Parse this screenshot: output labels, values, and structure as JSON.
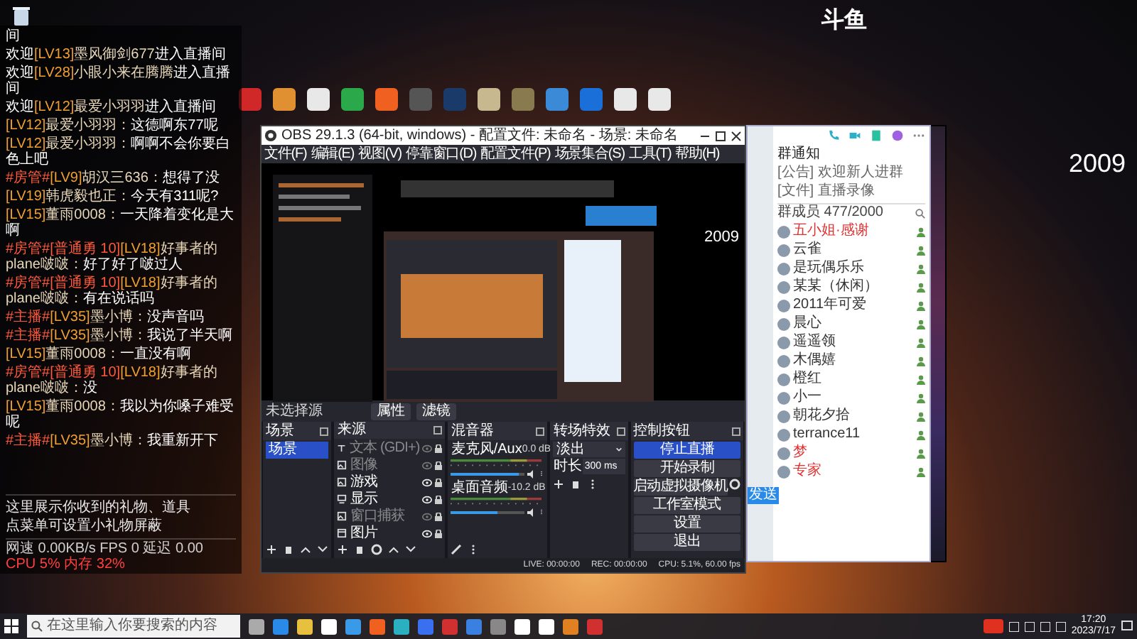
{
  "logo": "斗鱼",
  "counter": "2009",
  "chat": {
    "messages": [
      {
        "parts": [
          {
            "kind": "text",
            "text": "间"
          }
        ]
      },
      {
        "parts": [
          {
            "kind": "text",
            "text": "欢迎"
          },
          {
            "kind": "level",
            "text": "[LV13]"
          },
          {
            "kind": "user",
            "text": "墨风御剑677"
          },
          {
            "kind": "text",
            "text": "进入直播间"
          }
        ]
      },
      {
        "parts": [
          {
            "kind": "text",
            "text": "欢迎"
          },
          {
            "kind": "level",
            "text": "[LV28]"
          },
          {
            "kind": "user",
            "text": "小眼小来在腾腾"
          },
          {
            "kind": "text",
            "text": "进入直播间"
          }
        ]
      },
      {
        "parts": [
          {
            "kind": "text",
            "text": "欢迎"
          },
          {
            "kind": "level",
            "text": "[LV12]"
          },
          {
            "kind": "user",
            "text": "最爱小羽羽"
          },
          {
            "kind": "text",
            "text": "进入直播间"
          }
        ]
      },
      {
        "parts": [
          {
            "kind": "level",
            "text": "[LV12]"
          },
          {
            "kind": "user",
            "text": "最爱小羽羽："
          },
          {
            "kind": "text",
            "text": "这德啊东77呢"
          }
        ]
      },
      {
        "parts": [
          {
            "kind": "level",
            "text": "[LV12]"
          },
          {
            "kind": "user",
            "text": "最爱小羽羽："
          },
          {
            "kind": "text",
            "text": "啊啊不会你要白色上吧"
          }
        ]
      },
      {
        "parts": [
          {
            "kind": "badge",
            "text": "#房管#"
          },
          {
            "kind": "level",
            "text": "[LV9]"
          },
          {
            "kind": "user",
            "text": "胡汉三636："
          },
          {
            "kind": "text",
            "text": "想得了没"
          }
        ]
      },
      {
        "parts": [
          {
            "kind": "level",
            "text": "[LV19]"
          },
          {
            "kind": "user",
            "text": "韩虎毅也正："
          },
          {
            "kind": "text",
            "text": "今天有311呢?"
          }
        ]
      },
      {
        "parts": [
          {
            "kind": "level",
            "text": "[LV15]"
          },
          {
            "kind": "user",
            "text": "董雨0008："
          },
          {
            "kind": "text",
            "text": "一天降着变化是大啊"
          }
        ]
      },
      {
        "parts": [
          {
            "kind": "badge",
            "text": "#房管#[普通勇 10]"
          },
          {
            "kind": "level",
            "text": "[LV18]"
          },
          {
            "kind": "user",
            "text": "好事者的plane啵啵："
          },
          {
            "kind": "text",
            "text": "好了好了啵过人"
          }
        ]
      },
      {
        "parts": [
          {
            "kind": "badge",
            "text": "#房管#[普通勇 10]"
          },
          {
            "kind": "level",
            "text": "[LV18]"
          },
          {
            "kind": "user",
            "text": "好事者的plane啵啵："
          },
          {
            "kind": "text",
            "text": "有在说话吗"
          }
        ]
      },
      {
        "parts": [
          {
            "kind": "badge",
            "text": "#主播#"
          },
          {
            "kind": "level",
            "text": "[LV35]"
          },
          {
            "kind": "user",
            "text": "墨小博："
          },
          {
            "kind": "text",
            "text": "没声音吗"
          }
        ]
      },
      {
        "parts": [
          {
            "kind": "badge",
            "text": "#主播#"
          },
          {
            "kind": "level",
            "text": "[LV35]"
          },
          {
            "kind": "user",
            "text": "墨小博："
          },
          {
            "kind": "text",
            "text": "我说了半天啊"
          }
        ]
      },
      {
        "parts": [
          {
            "kind": "level",
            "text": "[LV15]"
          },
          {
            "kind": "user",
            "text": "董雨0008："
          },
          {
            "kind": "text",
            "text": "一直没有啊"
          }
        ]
      },
      {
        "parts": [
          {
            "kind": "badge",
            "text": "#房管#[普通勇 10]"
          },
          {
            "kind": "level",
            "text": "[LV18]"
          },
          {
            "kind": "user",
            "text": "好事者的plane啵啵："
          },
          {
            "kind": "text",
            "text": "没"
          }
        ]
      },
      {
        "parts": [
          {
            "kind": "level",
            "text": "[LV15]"
          },
          {
            "kind": "user",
            "text": "董雨0008："
          },
          {
            "kind": "text",
            "text": "我以为你嗓子难受呢"
          }
        ]
      },
      {
        "parts": [
          {
            "kind": "badge",
            "text": "#主播#"
          },
          {
            "kind": "level",
            "text": "[LV35]"
          },
          {
            "kind": "user",
            "text": "墨小博："
          },
          {
            "kind": "text",
            "text": "我重新开下"
          }
        ]
      }
    ],
    "footer": [
      "这里展示你收到的礼物、道具",
      "点菜单可设置小礼物屏蔽"
    ],
    "status_left": "网速 0.00KB/s FPS 0 延迟 0.00",
    "status_right": "CPU 5% 内存 32%"
  },
  "obs": {
    "title": "OBS 29.1.3 (64-bit, windows) - 配置文件: 未命名 - 场景: 未命名",
    "menu": [
      "文件(F)",
      "编辑(E)",
      "视图(V)",
      "停靠窗口(D)",
      "配置文件(P)",
      "场景集合(S)",
      "工具(T)",
      "帮助(H)"
    ],
    "preview_counter": "2009",
    "source_bar": {
      "label": "未选择源",
      "buttons": [
        "属性",
        "滤镜"
      ]
    },
    "scenes": {
      "title": "场景",
      "items": [
        {
          "name": "场景",
          "selected": true
        }
      ]
    },
    "sources": {
      "title": "来源",
      "items": [
        {
          "name": "文本 (GDI+)",
          "kind": "text",
          "visible": false
        },
        {
          "name": "图像",
          "kind": "image",
          "visible": false
        },
        {
          "name": "游戏",
          "kind": "image",
          "visible": true
        },
        {
          "name": "显示",
          "kind": "display",
          "visible": true
        },
        {
          "name": "窗口捕获",
          "kind": "image",
          "visible": false
        },
        {
          "name": "图片",
          "kind": "window",
          "visible": true
        }
      ]
    },
    "mixer": {
      "title": "混音器",
      "channels": [
        {
          "name": "麦克风/Aux",
          "reading": "0.0 dB",
          "level": 0.92
        },
        {
          "name": "桌面音频",
          "reading": "-10.2 dB",
          "level": 0.62
        }
      ]
    },
    "transitions": {
      "title": "转场特效",
      "type": "淡出",
      "duration_label": "时长",
      "duration": "300 ms"
    },
    "controls": {
      "title": "控制按钮",
      "buttons": [
        {
          "label": "停止直播",
          "kind": "primary"
        },
        {
          "label": "开始录制",
          "kind": "normal"
        },
        {
          "label": "启动虚拟摄像机",
          "kind": "settings"
        },
        {
          "label": "工作室模式",
          "kind": "normal"
        },
        {
          "label": "设置",
          "kind": "normal"
        },
        {
          "label": "退出",
          "kind": "normal"
        }
      ]
    },
    "status": [
      "LIVE: 00:00:00",
      "REC: 00:00:00",
      "CPU: 5.1%, 60.00 fps"
    ]
  },
  "qq": {
    "notice_title": "群通知",
    "notices": [
      "[公告] 欢迎新人进群",
      "[文件] 直播录像"
    ],
    "members_title": "群成员 477/2000",
    "members": [
      {
        "name": "五小姐·感谢",
        "color": "#e03030"
      },
      {
        "name": "云雀",
        "color": "#333333"
      },
      {
        "name": "是玩偶乐乐",
        "color": "#333333"
      },
      {
        "name": "某某（休闲）",
        "color": "#333333"
      },
      {
        "name": "2011年可爱",
        "color": "#333333"
      },
      {
        "name": "晨心",
        "color": "#333333"
      },
      {
        "name": "遥遥领",
        "color": "#333333"
      },
      {
        "name": "木偶嬉",
        "color": "#333333"
      },
      {
        "name": "橙红",
        "color": "#333333"
      },
      {
        "name": "小一",
        "color": "#333333"
      },
      {
        "name": "朝花夕拾",
        "color": "#333333"
      },
      {
        "name": "terrance11",
        "color": "#333333"
      },
      {
        "name": "梦",
        "color": "#e03030"
      },
      {
        "name": "专家",
        "color": "#e03030"
      }
    ],
    "send": "发送"
  },
  "taskbar": {
    "search_placeholder": "在这里输入你要搜索的内容",
    "time": "17:20",
    "date": "2023/7/17"
  }
}
